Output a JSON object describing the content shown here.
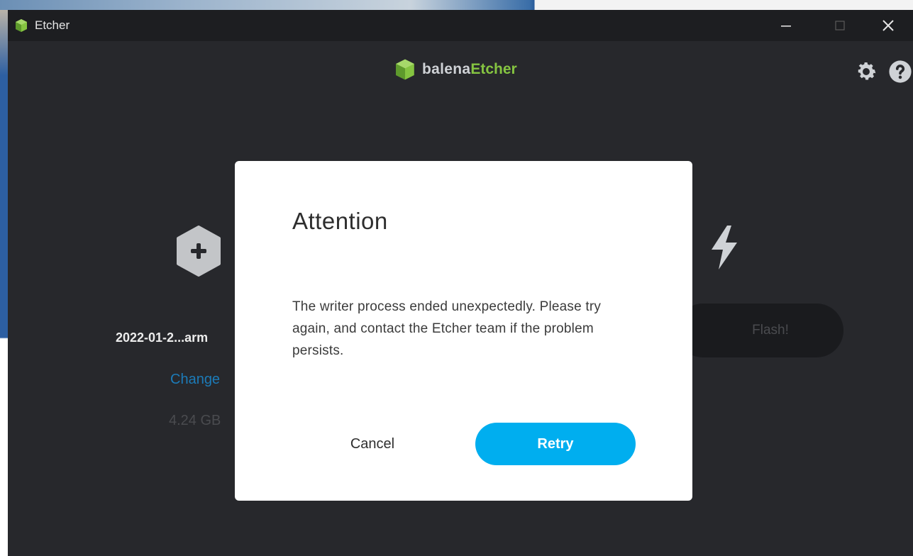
{
  "window": {
    "title": "Etcher"
  },
  "brand": {
    "prefix": "balena",
    "name": "Etcher"
  },
  "colors": {
    "accent": "#00aeef",
    "brand_green": "#85c441",
    "link": "#1c7bb8",
    "window_bg": "#27282c"
  },
  "steps": {
    "image": {
      "icon": "plus-hexagon-icon",
      "name": "2022-01-2...arm",
      "change_label": "Change",
      "size": "4.24 GB"
    },
    "flash": {
      "icon": "lightning-icon",
      "button_label": "Flash!"
    }
  },
  "dialog": {
    "title": "Attention",
    "message": "The writer process ended unexpectedly. Please try again, and contact the Etcher team if the problem persists.",
    "cancel_label": "Cancel",
    "retry_label": "Retry"
  }
}
